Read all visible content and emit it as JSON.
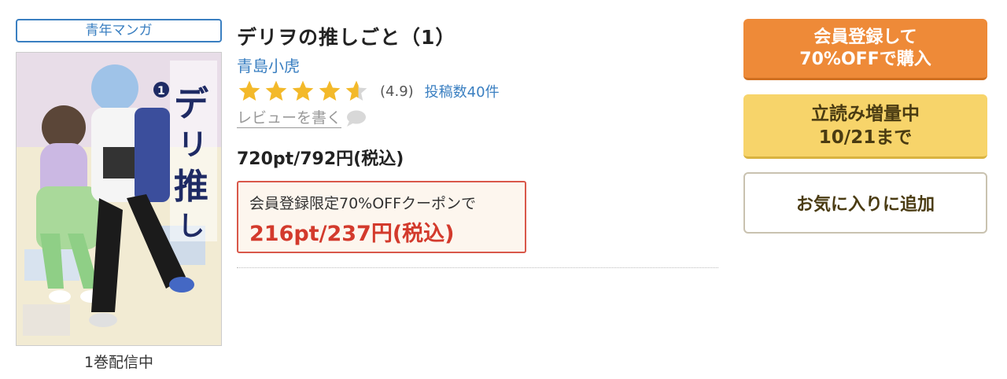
{
  "product": {
    "genre": "青年マンガ",
    "title": "デリヲの推しごと（1）",
    "author": "青島小虎",
    "rating_value": "(4.9)",
    "rating": 4.9,
    "rating_max": 5,
    "review_count": "投稿数40件",
    "write_review": "レビューを書く",
    "price": "720pt/792円(税込)",
    "volumes": "1巻配信中"
  },
  "coupon": {
    "label": "会員登録限定70%OFFクーポンで",
    "price": "216pt/237円(税込)"
  },
  "buttons": {
    "buy_line1": "会員登録して",
    "buy_line2": "70%OFFで購入",
    "preview_line1": "立読み増量中",
    "preview_line2": "10/21まで",
    "favorite": "お気に入りに追加"
  },
  "colors": {
    "link": "#3a7fc1",
    "star": "#f3b92a",
    "buy_button": "#ee8a38",
    "preview_button": "#f7d46a",
    "coupon_price": "#d33a2c"
  }
}
